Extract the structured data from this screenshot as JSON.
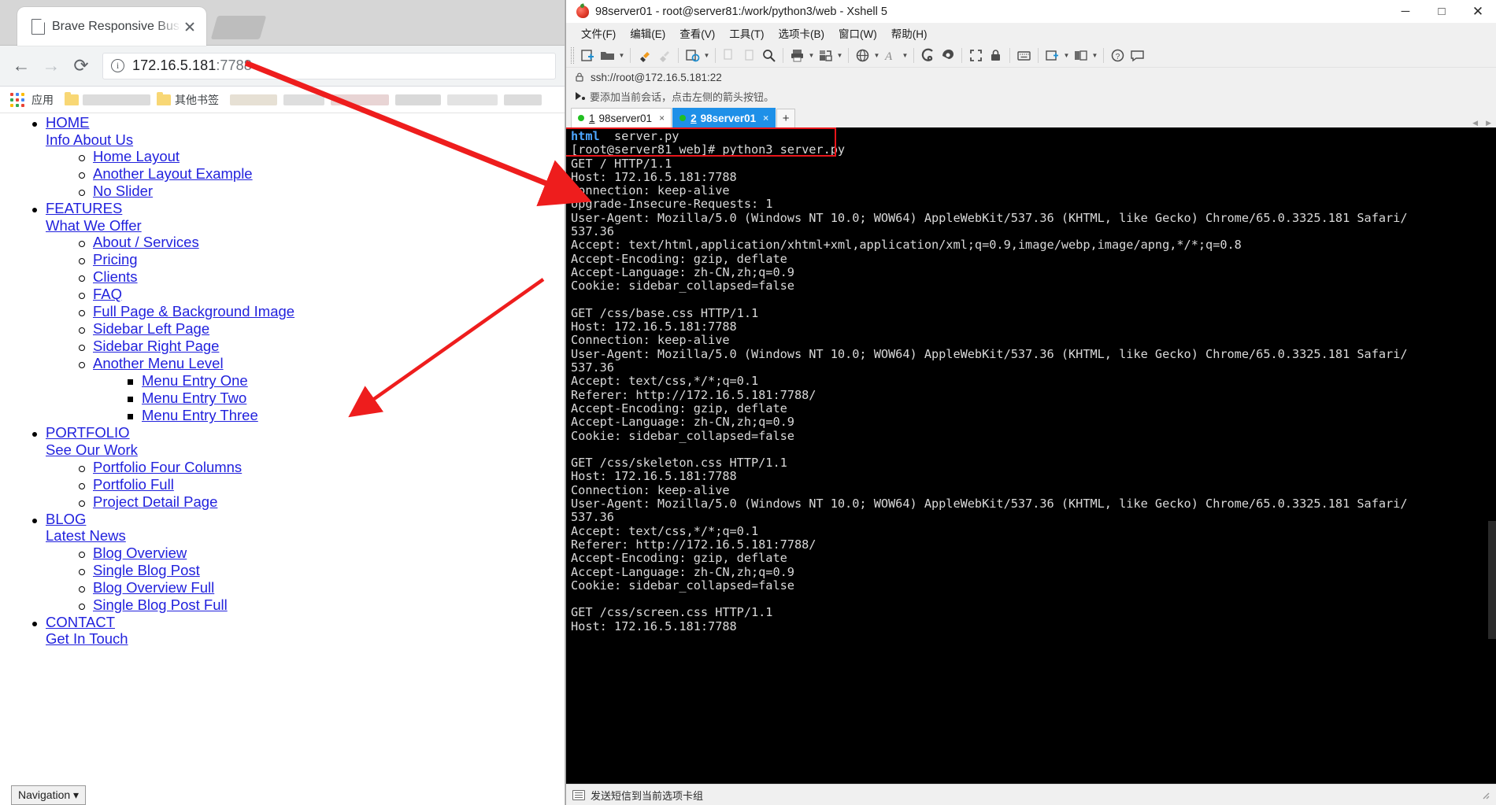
{
  "browser": {
    "tab": {
      "title": "Brave Responsive Busi",
      "favicon_icon": "page-icon",
      "close_icon": "close-icon"
    },
    "nav": {
      "back_icon": "back-arrow-icon",
      "forward_icon": "forward-arrow-icon",
      "reload_icon": "reload-icon"
    },
    "omnibox": {
      "info_icon": "info-circle-icon",
      "host": "172.16.5.181",
      "port": ":7788"
    },
    "bookmarks": {
      "apps_icon": "apps-grid-icon",
      "apps_label": "应用",
      "other_label": "其他书签",
      "folder_icon": "folder-icon"
    }
  },
  "page": {
    "footer_label": "Navigation",
    "footer_caret": "▾",
    "menu": [
      {
        "title": "HOME",
        "subtitle": "Info About Us",
        "children": [
          {
            "label": "Home Layout"
          },
          {
            "label": "Another Layout Example"
          },
          {
            "label": "No Slider"
          }
        ]
      },
      {
        "title": "FEATURES",
        "subtitle": "What We Offer",
        "children": [
          {
            "label": "About / Services"
          },
          {
            "label": "Pricing"
          },
          {
            "label": "Clients"
          },
          {
            "label": "FAQ"
          },
          {
            "label": "Full Page & Background Image"
          },
          {
            "label": "Sidebar Left Page"
          },
          {
            "label": "Sidebar Right Page"
          },
          {
            "label": "Another Menu Level",
            "children": [
              {
                "label": "Menu Entry One"
              },
              {
                "label": "Menu Entry Two"
              },
              {
                "label": "Menu Entry Three"
              }
            ]
          }
        ]
      },
      {
        "title": "PORTFOLIO",
        "subtitle": "See Our Work",
        "children": [
          {
            "label": "Portfolio Four Columns"
          },
          {
            "label": "Portfolio Full"
          },
          {
            "label": "Project Detail Page"
          }
        ]
      },
      {
        "title": "BLOG",
        "subtitle": "Latest News",
        "children": [
          {
            "label": "Blog Overview"
          },
          {
            "label": "Single Blog Post"
          },
          {
            "label": "Blog Overview Full"
          },
          {
            "label": "Single Blog Post Full"
          }
        ]
      },
      {
        "title": "CONTACT",
        "subtitle": "Get In Touch",
        "children": []
      }
    ]
  },
  "xshell": {
    "title": "98server01 - root@server81:/work/python3/web - Xshell 5",
    "logo_icon": "xshell-logo-icon",
    "window_controls": {
      "minimize": "─",
      "minimize_icon": "minimize-icon",
      "maximize": "□",
      "maximize_icon": "maximize-icon",
      "close": "✕",
      "close_icon": "close-icon"
    },
    "menu": [
      "文件(F)",
      "编辑(E)",
      "查看(V)",
      "工具(T)",
      "选项卡(B)",
      "窗口(W)",
      "帮助(H)"
    ],
    "address": {
      "lock_icon": "lock-icon",
      "url": "ssh://root@172.16.5.181:22"
    },
    "hint": {
      "icon": "arrow-session-icon",
      "text": "要添加当前会话，点击左侧的箭头按钮。"
    },
    "tabs": [
      {
        "num": "1",
        "name": "98server01",
        "active": false,
        "close": "×"
      },
      {
        "num": "2",
        "name": "98server01",
        "active": true,
        "close": "×"
      }
    ],
    "tab_add_label": "+",
    "status": {
      "icon": "send-note-icon",
      "text": "发送短信到当前选项卡组"
    },
    "highlight_color": "#e8161b",
    "accent_color": "#1e90e8",
    "terminal": {
      "prompt_keyword": "html",
      "prompt_file": "server.py",
      "prompt_command": "[root@server81 web]# python3 server.py",
      "lines": [
        "GET / HTTP/1.1",
        "Host: 172.16.5.181:7788",
        "Connection: keep-alive",
        "Upgrade-Insecure-Requests: 1",
        "User-Agent: Mozilla/5.0 (Windows NT 10.0; WOW64) AppleWebKit/537.36 (KHTML, like Gecko) Chrome/65.0.3325.181 Safari/",
        "537.36",
        "Accept: text/html,application/xhtml+xml,application/xml;q=0.9,image/webp,image/apng,*/*;q=0.8",
        "Accept-Encoding: gzip, deflate",
        "Accept-Language: zh-CN,zh;q=0.9",
        "Cookie: sidebar_collapsed=false",
        "",
        "GET /css/base.css HTTP/1.1",
        "Host: 172.16.5.181:7788",
        "Connection: keep-alive",
        "User-Agent: Mozilla/5.0 (Windows NT 10.0; WOW64) AppleWebKit/537.36 (KHTML, like Gecko) Chrome/65.0.3325.181 Safari/",
        "537.36",
        "Accept: text/css,*/*;q=0.1",
        "Referer: http://172.16.5.181:7788/",
        "Accept-Encoding: gzip, deflate",
        "Accept-Language: zh-CN,zh;q=0.9",
        "Cookie: sidebar_collapsed=false",
        "",
        "GET /css/skeleton.css HTTP/1.1",
        "Host: 172.16.5.181:7788",
        "Connection: keep-alive",
        "User-Agent: Mozilla/5.0 (Windows NT 10.0; WOW64) AppleWebKit/537.36 (KHTML, like Gecko) Chrome/65.0.3325.181 Safari/",
        "537.36",
        "Accept: text/css,*/*;q=0.1",
        "Referer: http://172.16.5.181:7788/",
        "Accept-Encoding: gzip, deflate",
        "Accept-Language: zh-CN,zh;q=0.9",
        "Cookie: sidebar_collapsed=false",
        "",
        "GET /css/screen.css HTTP/1.1",
        "Host: 172.16.5.181:7788"
      ]
    }
  }
}
